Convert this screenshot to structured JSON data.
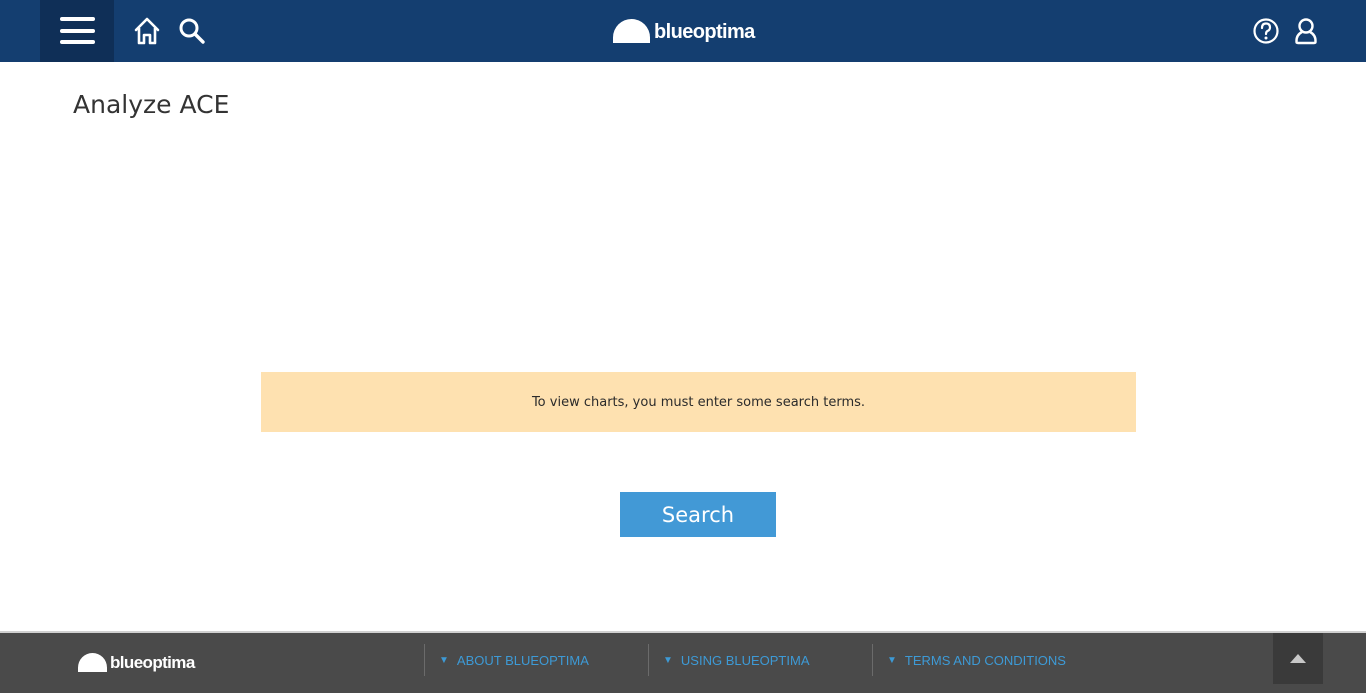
{
  "header": {
    "brand_name": "blueoptima",
    "icons": [
      "menu-icon",
      "home-icon",
      "search-icon",
      "help-icon",
      "user-icon"
    ]
  },
  "main": {
    "title": "Analyze ACE",
    "alert_message": "To view charts, you must enter some search terms.",
    "search_button_label": "Search"
  },
  "footer": {
    "brand_name": "blueoptima",
    "links": [
      {
        "label": "ABOUT BLUEOPTIMA"
      },
      {
        "label": "USING BLUEOPTIMA"
      },
      {
        "label": "TERMS AND CONDITIONS"
      }
    ],
    "scroll_top_icon": "arrow-up-icon"
  },
  "colors": {
    "header_bg": "#143e70",
    "alert_bg": "#fee1b0",
    "button_bg": "#4299d6",
    "footer_bg": "#4a4a4a",
    "footer_link": "#3d9ad6"
  }
}
